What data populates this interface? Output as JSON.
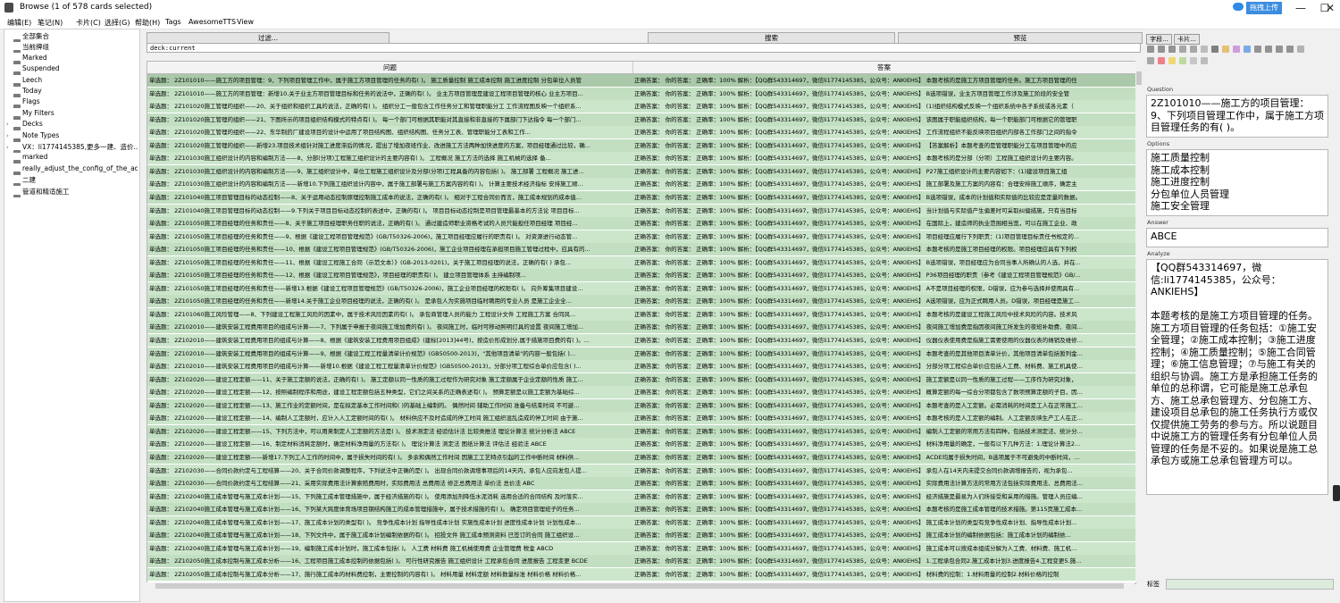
{
  "window": {
    "title": "Browse (1 of 578 cards selected)",
    "upload_label": "拖拽上传",
    "minimize": "—",
    "maximize": "☐",
    "close": "✕"
  },
  "menu": [
    "编辑(E)",
    "笔记(N)",
    "卡片(C)",
    "选择(G)",
    "帮助(H)",
    "Tags",
    "AwesomeTTS",
    "View"
  ],
  "sidebar": {
    "items": [
      {
        "label": "全部集合",
        "icon": "collection-icon"
      },
      {
        "label": "当前牌组",
        "icon": "deck-icon"
      },
      {
        "label": "Marked",
        "icon": "tag-icon"
      },
      {
        "label": "Suspended",
        "icon": "tag-icon"
      },
      {
        "label": "Leech",
        "icon": "tag-icon"
      },
      {
        "label": "Today",
        "icon": "clock-icon"
      },
      {
        "label": "Flags",
        "icon": "flag-icon"
      },
      {
        "label": "My Filters",
        "icon": "heart-icon"
      },
      {
        "label": "Decks",
        "icon": "deck-icon"
      },
      {
        "label": "Note Types",
        "icon": "note-type-icon"
      },
      {
        "label": "VX：li1774145385,更多一建、造价...",
        "icon": "tag-icon"
      },
      {
        "label": "marked",
        "icon": "tag-icon"
      },
      {
        "label": "really_adjust_the_config_of_the_ad...",
        "icon": "tag-icon"
      },
      {
        "label": "二建",
        "icon": "tag-icon"
      },
      {
        "label": "管道和精适施工",
        "icon": "tag-icon"
      }
    ]
  },
  "toolbar": {
    "filter_label": "过滤...",
    "search_label": "搜索",
    "preview_label": "预览",
    "search_value": "deck:current"
  },
  "table": {
    "columns": [
      "问题",
      "答案"
    ],
    "rows": [
      {
        "q": "单选题： 2Z101010——施工方的项目管理：9、下列项目管理工作中，属于施工方项目管理的任务的有(     )。   施工质量控制 施工成本控制 施工进度控制 分包单位人员管",
        "a": "正确答案：      你的答案：     正确率：100%  解析：【QQ群543314697，微信li1774145385，公众号：ANKIEHS】   本题考核的是施工方项目管理的任务。施工方项目管理的任"
      },
      {
        "q": "单选题： 2Z101010——施工方的项目管理：新增10.关于业主方项目管理目标和任务的说法中，正确的有(     )。   业主方项目管理是建设工程项目管理的核心 业主方项目...",
        "a": "正确答案：      你的答案：     正确率：100%  解析：【QQ群543314697，微信li1774145385，公众号：ANKIEHS】   B选项错误，业主方项目管理工作涉及施工阶段的安全管"
      },
      {
        "q": "单选题： 2Z101020施工管理的组织——20、关于组织和组织工具的说法，正确的有(     )。   组织分工一般包含工作任务分工和管理职能分工 工作流程图反映一个组织系...",
        "a": "正确答案：      你的答案：     正确率：100%  解析：【QQ群543314697，微信li1774145385，公众号：ANKIEHS】   (1)组织结构模式反映一个组织系统中各子系统或各元素（"
      },
      {
        "q": "单选题： 2Z101020施工管理的组织——21、下图所示的项目组织结构模式的特点有(     )。   每一个部门可根据其职能对其直接和非直接的下属部门下达指令 每一个部门...",
        "a": "正确答案：      你的答案：     正确率：100%  解析：【QQ群543314697，微信li1774145385，公众号：ANKIEHS】   该图属于职能组织结构，每一个职能部门可根据它的管理职"
      },
      {
        "q": "单选题： 2Z101020施工管理的组织——22、东华制药厂建设项目的设计中运用了项目结构图、组织结构图、任务分工表、管理职能分工表和工作...",
        "a": "正确答案：      你的答案：     正确率：100%  解析：【QQ群543314697，微信li1774145385，公众号：ANKIEHS】   工作流程组织不能反映项目组织内部各工作部门之间的指令"
      },
      {
        "q": "单选题： 2Z101020施工管理的组织——新增23.项目技术组针对施工进度滞后的情况，提出了增加夜班作业、改进施工方法两种加快进度的方案，项目经理通过比较，确...",
        "a": "正确答案：      你的答案：     正确率：100%  解析：【QQ群543314697，微信li1774145385，公众号：ANKIEHS】   【答案解析】本题考查的是管理职能分工在项目管理中的应"
      },
      {
        "q": "单选题： 2Z101030施工组织设计的内容和编制方法——8、分部(分项)工程施工组织设计的主要内容有(     )。   工程概况 施工方法的选择 施工机械的选择 备...",
        "a": "正确答案：      你的答案：     正确率：100%  解析：【QQ群543314697，微信li1774145385，公众号：ANKIEHS】   本题考核的是分部（分项）工程施工组织设计的主要内容。"
      },
      {
        "q": "单选题： 2Z101030施工组织设计的内容和编制方法——9、施工组织设计中，单位工程施工组织设计及分部(分项)工程具备的内容包括(     )。   施工部署 工程概况 施工进...",
        "a": "正确答案：      你的答案：     正确率：100%  解析：【QQ群543314697，微信li1774145385，公众号：ANKIEHS】   P27施工组织设计的主要内容如下：(1)建设项目施工组"
      },
      {
        "q": "单选题： 2Z101030施工组织设计的内容和编制方法——新增10.下列施工组织设计内容中，属于施工部署与施工方案内容的有(     )。   计算主要技术经济指标 安排施工顺...",
        "a": "正确答案：      你的答案：     正确率：100%  解析：【QQ群543314697，微信li1774145385，公众号：ANKIEHS】   施工部署及施工方案的内容有：合理安排施工顺序，确定主"
      },
      {
        "q": "单选题： 2Z101040施工项目管理目标的动态控制——8、关于运用动态控制原理控制施工成本的说法，正确的有(     )。   相对于工程合同价而言，施工成本规划的成本值...",
        "a": "正确答案：      你的答案：     正确率：100%  解析：【QQ群543314697，微信li1774145385，公众号：ANKIEHS】   B选项错误，成本的计划值和实际值的比较应是定量的数据。"
      },
      {
        "q": "单选题： 2Z101040施工项目管理目标的动态控制——9.下列关于项目目标动态控制的表述中，正确的有(     )。   项目目标动态控制是项目管理最基本的方法论 项目目标...",
        "a": "正确答案：      你的答案：     正确率：100%  解析：【QQ群543314697，微信li1774145385，公众号：ANKIEHS】   当计划值与实际值产生偏差时可采取纠偏措施，只有当目标"
      },
      {
        "q": "单选题： 2Z101050施工项目经理的任务和责任——8、关于施工项目经理职务任职的说法，正确的有(     )。   通过建造师职业资格考试的人员只能担任项目经理 项目经...",
        "a": "正确答案：      你的答案：     正确率：100%  解析：【QQ群543314697，微信li1774145385，公众号：ANKIEHS】   在国际上，建造师的执业范围相当宽，可以在施工企业、政"
      },
      {
        "q": "单选题： 2Z101050施工项目经理的任务和责任——9、根据《建设工程项目管理规范》(GB/T50326-2006)，施工项目经理应履行的职责有(     )。   对资源进行动态管...",
        "a": "正确答案：      你的答案：     正确率：100%  解析：【QQ群543314697，微信li1774145385，公众号：ANKIEHS】   项目经理应履行下列职责：(1)项目管理目标责任书规定的..."
      },
      {
        "q": "单选题： 2Z101050施工项目经理的任务和责任——10、根据《建设工程项目管理规范》(GB/T50326-2006)，施工企业项目经理在承担项目施工管理过程中，应具有的...",
        "a": "正确答案：      你的答案：     正确率：100%  解析：【QQ群543314697，微信li1774145385，公众号：ANKIEHS】   本题考核的是施工项目经理的权限。项目经理应具有下列权"
      },
      {
        "q": "单选题： 2Z101050施工项目经理的任务和责任——11、根据《建设工程施工合同（示范文本）》(GB-2013-0201)，关于施工项目经理的说法，正确的有(     )   承包...",
        "a": "正确答案：      你的答案：     正确率：100%  解析：【QQ群543314697，微信li1774145385，公众号：ANKIEHS】   B选项错误，项目经理应为合同当事人所确认的人选，并在..."
      },
      {
        "q": "单选题： 2Z101050施工项目经理的任务和责任——12、根据《建设工程项目管理规范》，项目经理的职责有(     )。   建立项目管理体系 主持编制项...",
        "a": "正确答案：      你的答案：     正确率：100%  解析：【QQ群543314697，微信li1774145385，公众号：ANKIEHS】   P36项目经理的职责（参考《建设工程项目管理规范》GB/..."
      },
      {
        "q": "单选题： 2Z101050施工项目经理的任务和责任——新增13.根据《建设工程项目管理规范》(GB/T50326-2006)，施工企业项目经理的权限有(     )。   向外筹集项目建设...",
        "a": "正确答案：      你的答案：     正确率：100%  解析：【QQ群543314697，微信li1774145385，公众号：ANKIEHS】   A不是项目经理的权限，D错误，应为参与选择并使用具有..."
      },
      {
        "q": "单选题： 2Z101050施工项目经理的任务和责任——新增14.关于施工企业项目经理的说法，正确的有(     )。   是承包人为实施项目临时聘用的专业人员 是施工企业全...",
        "a": "正确答案：      你的答案：     正确率：100%  解析：【QQ群543314697，微信li1774145385，公众号：ANKIEHS】   A选项错误，应为正式聘用人员。D错误，项目经理是施工..."
      },
      {
        "q": "单选题： 2Z101060施工风险管理——8、下列建设工程施工风险的因素中，属于技术风险因素的有(     )。   承包商管理人员的能力 工程设计文件 工程施工方案 合同风...",
        "a": "正确答案：      你的答案：     正确率：100%  解析：【QQ群543314697，微信li1774145385，公众号：ANKIEHS】   本题考核的是建设工程施工风险中技术风险的内容。技术风"
      },
      {
        "q": "单选题： 2Z102010——建筑安装工程费用项目的组成与计算——7、下列属于申报于夜间施工增加费的有(     )。   夜间施工时，临时可移动照明灯具的设置 夜间施工增加...",
        "a": "正确答案：      你的答案：     正确率：100%  解析：【QQ群543314697，微信li1774145385，公众号：ANKIEHS】   夜间施工增加费是指因夜间施工所发生的夜班补助费、夜间..."
      },
      {
        "q": "单选题： 2Z102010——建筑安装工程费用项目的组成与计算——8、根据《建筑安装工程费用项目组成》(建标[2013]44号)，按造价形成划分,属于措施项目费的有(     )。...",
        "a": "正确答案：      你的答案：     正确率：100%  解析：【QQ群543314697，微信li1774145385，公众号：ANKIEHS】   仪器仪表使用费是指施工需要使用的仪器仪表的摊销及维修..."
      },
      {
        "q": "单选题： 2Z102010——建筑安装工程费用项目的组成与计算——9、根据《建设工程工程量清单计价规范》(GB50500-2013)，\"其他项目清单\"的内容一般包括(     )...",
        "a": "正确答案：      你的答案：     正确率：100%  解析：【QQ群543314697，微信li1774145385，公众号：ANKIEHS】   本题考查的是其他项目清单计价，其他项目清单包括暂列金..."
      },
      {
        "q": "单选题： 2Z102010——建筑安装工程费用项目的组成与计算——新增10.根据《建设工程工程量清单计价规范》(GB50500-2013)，分部分项工程综合单价应包含(     )...",
        "a": "正确答案：      你的答案：     正确率：100%  解析：【QQ群543314697，微信li1774145385，公众号：ANKIEHS】   分部分项工程综合单价应包括人工费、材料费、施工机具使..."
      },
      {
        "q": "单选题： 2Z102020——建设工程定额——11、关于施工定额的说法，正确的有(     )。   施工定额以同一性质的施工过程作为研究对象 施工定额属于企业定额的性质 施工...",
        "a": "正确答案：      你的答案：     正确率：100%  解析：【QQ群543314697，微信li1774145385，公众号：ANKIEHS】   施工定额是以同一性质的施工过程——工序作为研究对象，"
      },
      {
        "q": "单选题： 2Z102020——建设工程定额——12、按照编制程序和用途，建设工程定额包括五种类型，它们之间关系的正确表述有(     )。   预算定额是以施工定额为基础综...",
        "a": "正确答案：      你的答案：     正确率：100%  解析：【QQ群543314697，微信li1774145385，公众号：ANKIEHS】   概算定额的每一综合分项都包含了数项预算定额的子目，因..."
      },
      {
        "q": "单选题： 2Z102020——建设工程定额——13、施工作业的定额时间，是在拟定基本工作时间和(     )的基础上编制的。   偶然时间 辅助工作时间 准备与结束时间 不可避...",
        "a": "正确答案：      你的答案：     正确率：100%  解析：【QQ群543314697，微信li1774145385，公众号：ANKIEHS】   本题考查的是人工定额。必需消耗的时间是工人在正常施工..."
      },
      {
        "q": "单选题： 2Z102020——建设工程定额——14、编制人工定额时，应计入人工定额时间的有(     )。   材料供应不及时造成的停工时间 施工组织混乱造成的停工时间 由于施...",
        "a": "正确答案：      你的答案：     正确率：100%  解析：【QQ群543314697，微信li1774145385，公众号：ANKIEHS】   本题考核的是人工定额的编制。人工定额反映生产工人在正..."
      },
      {
        "q": "单选题： 2Z102020——建设工程定额——15、下列方法中，可以用来制定人工定额的方法是(     )。   技术测定法 经验估计法 比较类推法 理论计算法 统计分析法 ABCE",
        "a": "正确答案：      你的答案：     正确率：100%  解析：【QQ群543314697，微信li1774145385，公众号：ANKIEHS】   编制人工定额的常用方法有四种，包括技术测定法、统计分..."
      },
      {
        "q": "单选题： 2Z102020——建设工程定额——16、制定材料消耗定额时，确定材料净用量的方法有(     )。   理论计算法 测定法 图纸计算法 评估法 经验法 ABCE",
        "a": "正确答案：      你的答案：     正确率：100%  解析：【QQ群543314697，微信li1774145385，公众号：ANKIEHS】   材料净用量的确定，一般有以下几种方法：1.理论计算法2..."
      },
      {
        "q": "单选题： 2Z102020——建设工程定额——新增17.下列工人工作的时间中，属于损失时间的有(     )。   多余和偶然工作时间 因施工工艺特点引起的工作中断时间 材料供...",
        "a": "正确答案：      你的答案：     正确率：100%  解析：【QQ群543314697，微信li1774145385，公众号：ANKIEHS】   ACDE均属于损失时间，B选项属于不可避免的中断时间，..."
      },
      {
        "q": "单选题： 2Z102030——合同价款约定与工程结算——20、关于合同价款调整程序，下列说法中正确的是(     )。   出现合同价款调增事项后的14天内，承包人应向发包人提...",
        "a": "正确答案：      你的答案：     正确率：100%  解析：【QQ群543314697，微信li1774145385，公众号：ANKIEHS】   承包人在14天内未提交合同价款调增报告的，视为承包..."
      },
      {
        "q": "单选题： 2Z102030——合同价款约定与工程结算——21、采用实际费用法计算索赔费用时，实际费用法 总费用法 修正总费用法 单价法 总价法 ABC",
        "a": "正确答案：      你的答案：     正确率：100%  解析：【QQ群543314697，微信li1774145385，公众号：ANKIEHS】   实际费用法计算方法的常用方法包括实际费用法、总费用法..."
      },
      {
        "q": "单选题： 2Z102040施工成本管理与施工成本计划——15、下列施工成本管理措施中，属于经济措施的有(     )。   使用添加剂降低水泥消耗 选用合适的合同结构 及时落实...",
        "a": "正确答案：      你的答案：     正确率：100%  解析：【QQ群543314697，微信li1774145385，公众号：ANKIEHS】   经济措施是最易为人们所接受和采用的措施。管理人员应编..."
      },
      {
        "q": "单选题： 2Z102040施工成本管理与施工成本计划——16、下列某大跨度体育场项目钢结构施工的成本管理措施中，属于技术措施的有(     )。   确定项目管理班子的任务...",
        "a": "正确答案：      你的答案：     正确率：100%  解析：【QQ群543314697，微信li1774145385，公众号：ANKIEHS】   本题考核的是施工成本管理的技术措施。第115页施工成本..."
      },
      {
        "q": "单选题： 2Z102040施工成本管理与施工成本计划——17、施工成本计划的类型有(     )。   竞争性成本计划 指导性成本计划 实施性成本计划 进度性成本计划 计划性成本...",
        "a": "正确答案：      你的答案：     正确率：100%  解析：【QQ群543314697，微信li1774145385，公众号：ANKIEHS】   施工成本计划的类型有竞争性成本计划、指导性成本计划..."
      },
      {
        "q": "单选题： 2Z102040施工成本管理与施工成本计划——18、下列文件中，属于施工成本计划编制依据的有(     )。   招投文件 施工成本预测资料 已签订的合同 施工组织设...",
        "a": "正确答案：      你的答案：     正确率：100%  解析：【QQ群543314697，微信li1774145385，公众号：ANKIEHS】   施工成本计划的编制依据包括：施工成本计划的编制依..."
      },
      {
        "q": "单选题： 2Z102040施工成本管理与施工成本计划——19、编制施工成本计划时，施工成本包括(     )。   人工费 材料费 施工机械使用费 企业管理费 税金 ABCD",
        "a": "正确答案：      你的答案：     正确率：100%  解析：【QQ群543314697，微信li1774145385，公众号：ANKIEHS】   施工成本可以按成本组成分解为人工费、材料费、施工机..."
      },
      {
        "q": "单选题： 2Z102050施工成本控制与施工成本分析——16、工程项目施工成本控制的依据包括(     )。   可行性研究报告 施工组织设计 工程承包合同 进度报告 工程变更 BCDE",
        "a": "正确答案：      你的答案：     正确率：100%  解析：【QQ群543314697，微信li1774145385，公众号：ANKIEHS】   1.工程承包合同2.施工成本计划3.进度报告4.工程变更5.施..."
      },
      {
        "q": "单选题： 2Z102050施工成本控制与施工成本分析——17、施行施工成本的材料费控制，主要控制的内容有(     )。   材料用量 材料定额 材料数量标准 材料价格 材料价格...",
        "a": "正确答案：      你的答案：     正确率：100%  解析：【QQ群543314697，微信li1774145385，公众号：ANKIEHS】   材料费的控制：1.材料用量的控制2.材料价格的控制"
      }
    ]
  },
  "editor": {
    "fields_button": "字段...",
    "cards_button": "卡片...",
    "fields": [
      {
        "label": "Question",
        "value": "2Z101010——施工方的项目管理：9、下列项目管理工作中，属于施工方项目管理任务的有( )。"
      },
      {
        "label": "Options",
        "lines": [
          "施工质量控制",
          "施工成本控制",
          "施工进度控制",
          "分包单位人员管理",
          "施工安全管理"
        ]
      },
      {
        "label": "Answer",
        "value": "ABCE"
      },
      {
        "label": "Analyze",
        "value": "【QQ群543314697，微信:li1774145385，公众号：ANKIEHS】\n\n本题考核的是施工方项目管理的任务。施工方项目管理的任务包括：①施工安全管理；②施工成本控制；③施工进度控制；④施工质量控制；⑤施工合同管理；⑥施工信息管理；⑦与施工有关的组织与协调。施工方是承担施工任务的单位的总称谓，它可能是施工总承包方、施工总承包管理方、分包施工方、建设项目总承包的施工任务执行方或仅仅提供施工劳务的参与方。所以说题目中说施工方的管理任务有分包单位人员管理的任务是不妥的。如果说是施工总承包方或施工总承包管理方可以。"
      }
    ],
    "tags_label": "标签",
    "tags_value": ""
  }
}
